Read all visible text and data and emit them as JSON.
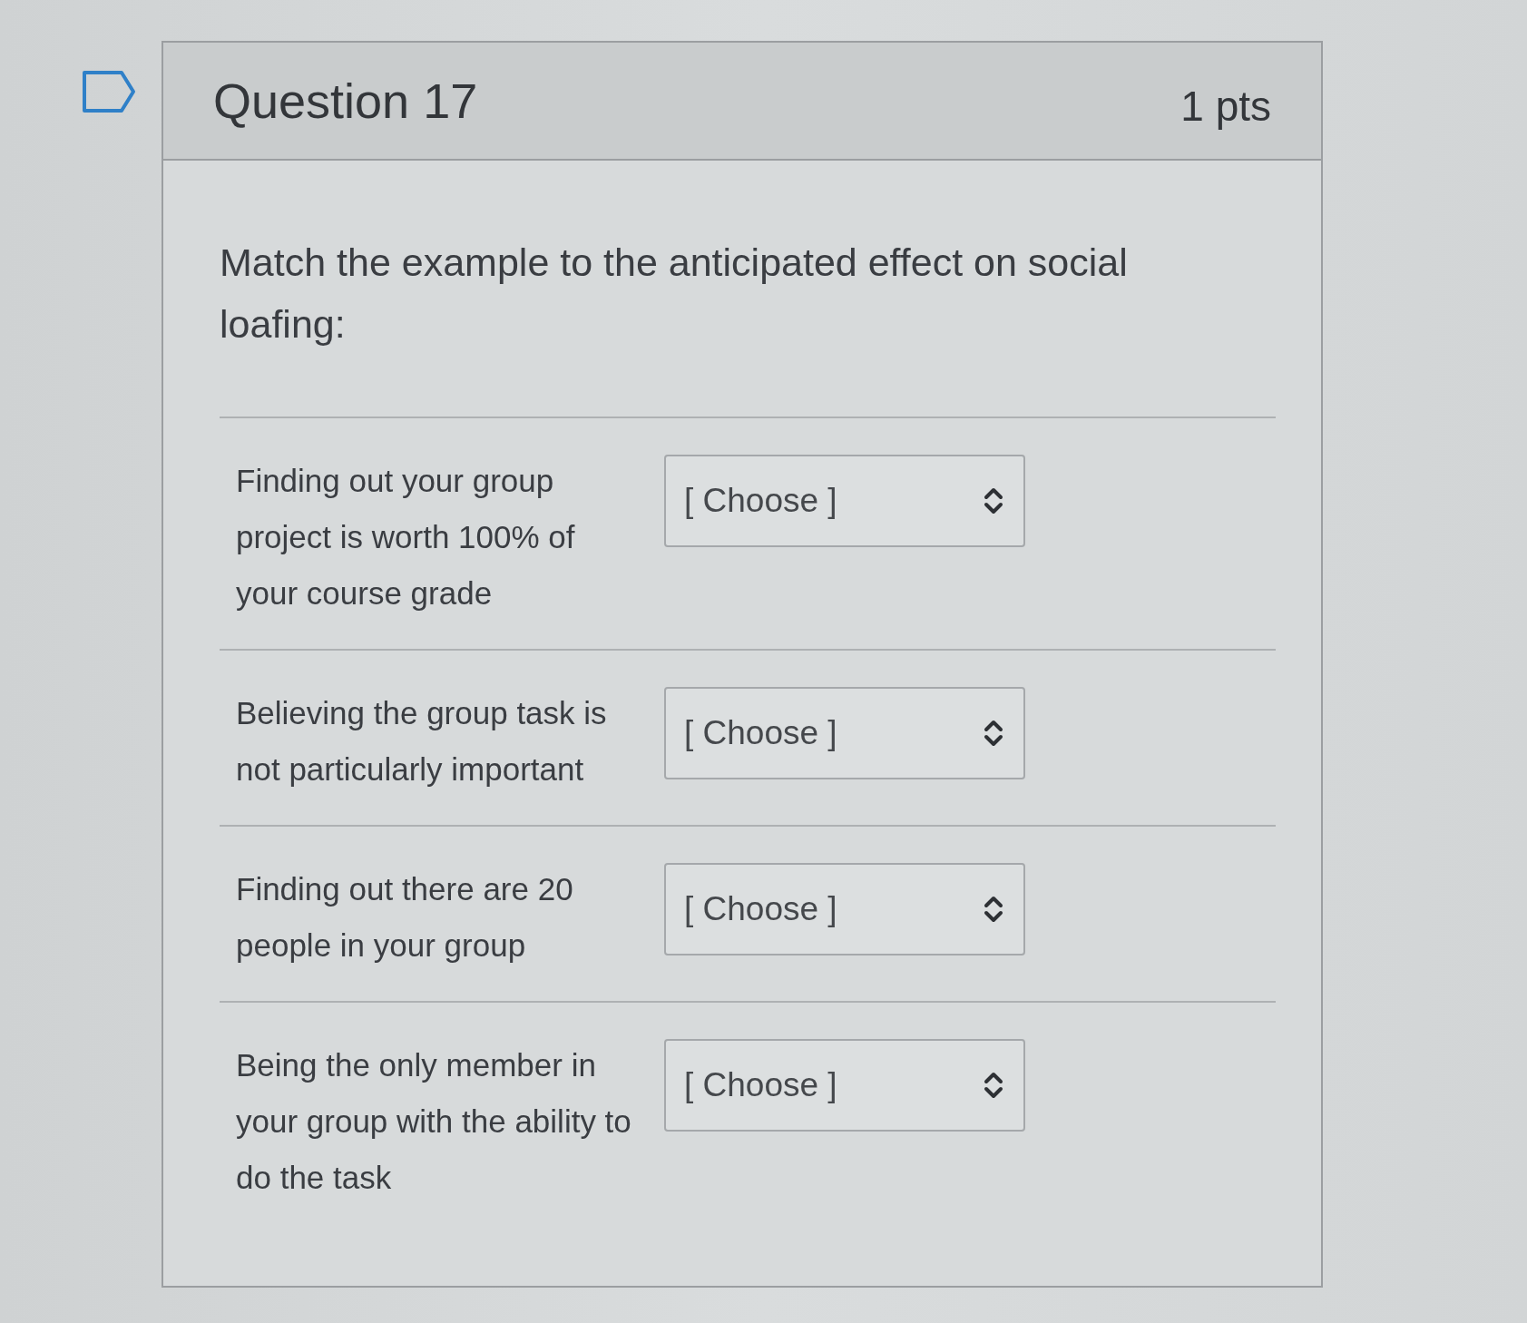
{
  "question": {
    "title": "Question 17",
    "points": "1 pts"
  },
  "prompt": "Match the example to the anticipated effect on social loafing:",
  "matches": [
    {
      "example": "Finding out your group project is worth 100% of your course grade",
      "answer": "[ Choose ]"
    },
    {
      "example": "Believing the group task is not particularly important",
      "answer": "[ Choose ]"
    },
    {
      "example": "Finding out there are 20 people in your group",
      "answer": "[ Choose ]"
    },
    {
      "example": "Being the only member in your group with the ability to do the task",
      "answer": "[ Choose ]"
    }
  ]
}
